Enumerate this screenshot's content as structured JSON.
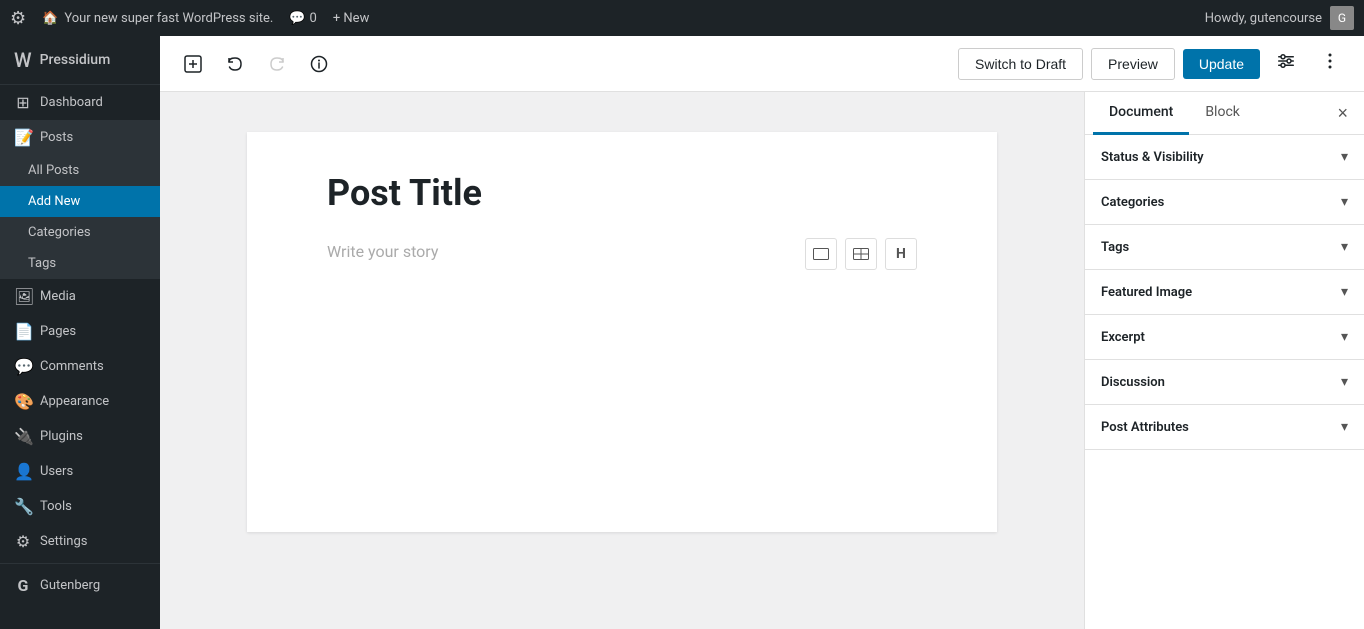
{
  "adminBar": {
    "logo": "⚙",
    "siteName": "Your new super fast WordPress site.",
    "houseIcon": "🏠",
    "commentsLabel": "0",
    "newLabel": "+ New",
    "howdyLabel": "Howdy, gutencourse",
    "avatarInitial": "G"
  },
  "sidebar": {
    "brandName": "Pressidium",
    "brandIcon": "W",
    "items": [
      {
        "id": "dashboard",
        "label": "Dashboard",
        "icon": "⊞"
      },
      {
        "id": "posts",
        "label": "Posts",
        "icon": "📝",
        "active": true,
        "hasSubmenu": true
      },
      {
        "id": "all-posts",
        "label": "All Posts",
        "submenu": true
      },
      {
        "id": "add-new",
        "label": "Add New",
        "submenu": true,
        "active": true
      },
      {
        "id": "categories",
        "label": "Categories",
        "submenu": true
      },
      {
        "id": "tags",
        "label": "Tags",
        "submenu": true
      },
      {
        "id": "media",
        "label": "Media",
        "icon": "🖼"
      },
      {
        "id": "pages",
        "label": "Pages",
        "icon": "📄"
      },
      {
        "id": "comments",
        "label": "Comments",
        "icon": "💬"
      },
      {
        "id": "appearance",
        "label": "Appearance",
        "icon": "🎨"
      },
      {
        "id": "plugins",
        "label": "Plugins",
        "icon": "🔌"
      },
      {
        "id": "users",
        "label": "Users",
        "icon": "👤"
      },
      {
        "id": "tools",
        "label": "Tools",
        "icon": "🔧"
      },
      {
        "id": "settings",
        "label": "Settings",
        "icon": "⚙"
      },
      {
        "id": "gutenberg",
        "label": "Gutenberg",
        "icon": "G"
      }
    ]
  },
  "toolbar": {
    "addBlockTitle": "+",
    "undoTitle": "↩",
    "redoTitle": "↪",
    "infoTitle": "ℹ",
    "switchToDraftLabel": "Switch to Draft",
    "previewLabel": "Preview",
    "updateLabel": "Update",
    "settingsIcon": "⚙",
    "moreIcon": "⋮"
  },
  "editor": {
    "postTitle": "Post Title",
    "writeStoryPlaceholder": "Write your story",
    "blockTool1": "▭",
    "blockTool2": "⊟",
    "blockTool3": "H"
  },
  "rightPanel": {
    "documentTab": "Document",
    "blockTab": "Block",
    "closeIcon": "×",
    "sections": [
      {
        "id": "status-visibility",
        "title": "Status & Visibility"
      },
      {
        "id": "categories",
        "title": "Categories"
      },
      {
        "id": "tags",
        "title": "Tags"
      },
      {
        "id": "featured-image",
        "title": "Featured Image"
      },
      {
        "id": "excerpt",
        "title": "Excerpt"
      },
      {
        "id": "discussion",
        "title": "Discussion"
      },
      {
        "id": "post-attributes",
        "title": "Post Attributes"
      }
    ]
  }
}
